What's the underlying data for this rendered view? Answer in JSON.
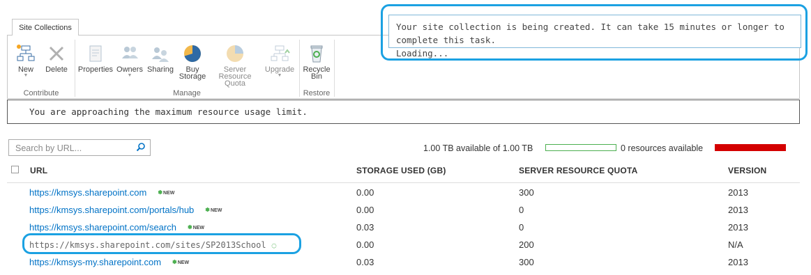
{
  "ribbon": {
    "tab": "Site Collections",
    "buttons": {
      "new": "New",
      "delete": "Delete",
      "properties": "Properties",
      "owners": "Owners",
      "sharing": "Sharing",
      "buy_storage_1": "Buy",
      "buy_storage_2": "Storage",
      "server_quota_1": "Server Resource",
      "server_quota_2": "Quota",
      "upgrade": "Upgrade",
      "recycle_1": "Recycle",
      "recycle_2": "Bin"
    },
    "groups": {
      "contribute": "Contribute",
      "manage": "Manage",
      "restore": "Restore"
    }
  },
  "warning": "You are approaching the maximum resource usage limit.",
  "status": {
    "line1": "Your site collection is being created. It can take 15 minutes or longer to complete this task.",
    "line2": "Loading..."
  },
  "search": {
    "placeholder": "Search by URL..."
  },
  "storage": {
    "text": "1.00 TB available of 1.00 TB",
    "available_fraction": 1.0,
    "resources_text": "0 resources available",
    "resource_bar_color": "#d40000"
  },
  "table": {
    "headers": {
      "url": "URL",
      "storage": "STORAGE USED (GB)",
      "quota": "SERVER RESOURCE QUOTA",
      "version": "VERSION"
    },
    "rows": [
      {
        "url": "https://kmsys.sharepoint.com",
        "new": "NEW",
        "storage": "0.00",
        "quota": "300",
        "version": "2013"
      },
      {
        "url": "https://kmsys.sharepoint.com/portals/hub",
        "new": "NEW",
        "storage": "0.00",
        "quota": "0",
        "version": "2013"
      },
      {
        "url": "https://kmsys.sharepoint.com/search",
        "new": "NEW",
        "storage": "0.03",
        "quota": "0",
        "version": "2013"
      },
      {
        "url": "https://kmsys.sharepoint.com/sites/SP2013School",
        "new": "",
        "storage": "0.00",
        "quota": "200",
        "version": "N/A"
      },
      {
        "url": "https://kmsys-my.sharepoint.com",
        "new": "NEW",
        "storage": "0.03",
        "quota": "300",
        "version": "2013"
      }
    ]
  },
  "colors": {
    "accent": "#0072c6",
    "highlight": "#1ba1e2",
    "new_badge": "#4caf50"
  }
}
